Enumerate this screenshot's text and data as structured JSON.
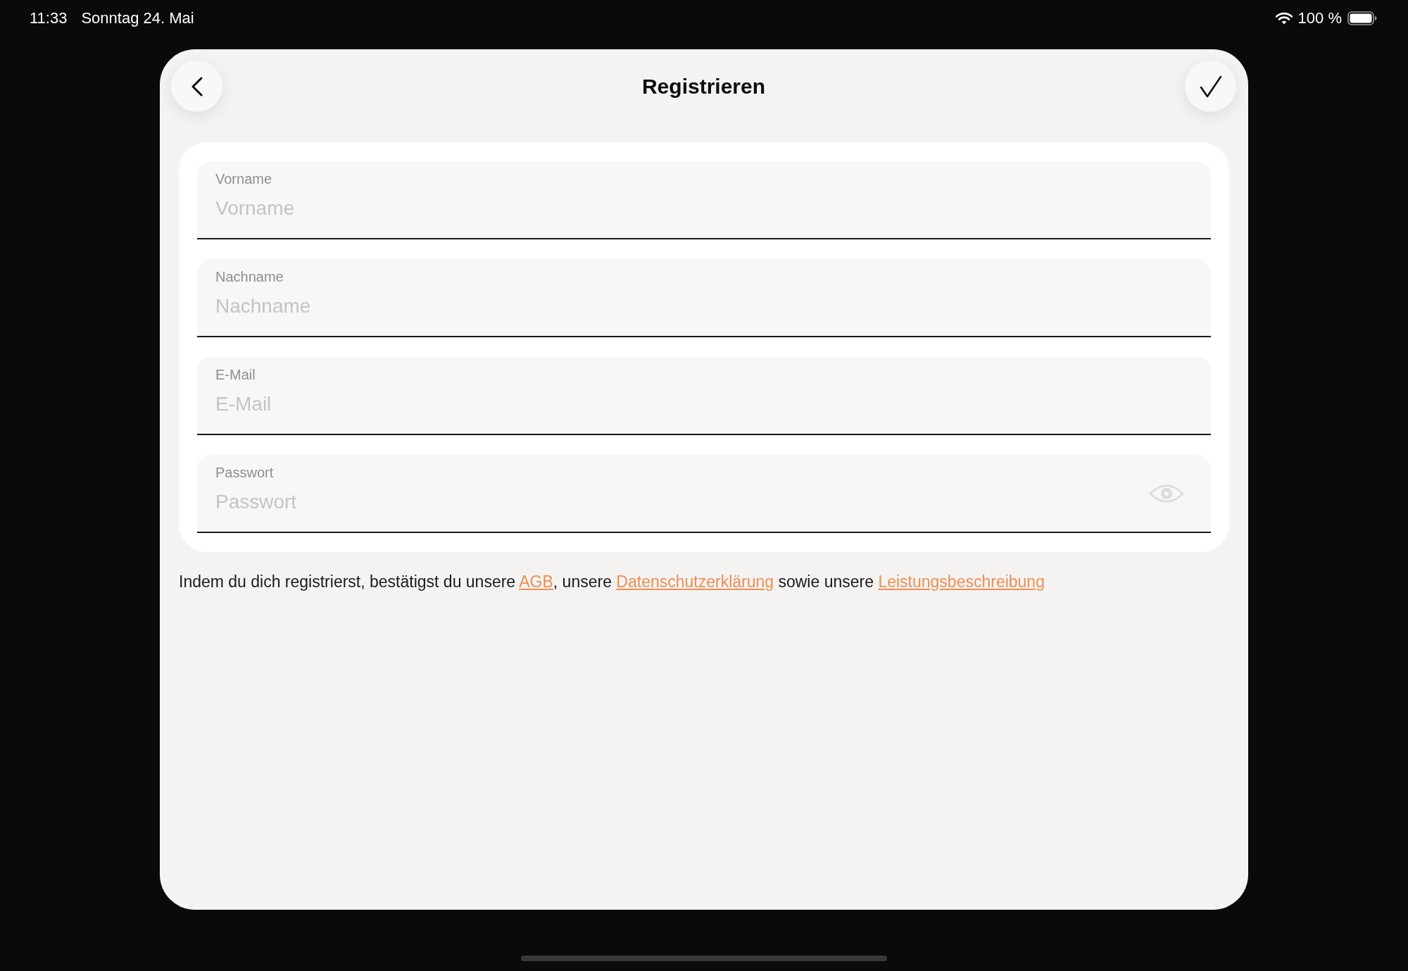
{
  "status_bar": {
    "time": "11:33",
    "date": "Sonntag 24. Mai",
    "battery": "100 %"
  },
  "header": {
    "title": "Registrieren"
  },
  "form": {
    "fields": [
      {
        "kind": "text",
        "label": "Vorname",
        "placeholder": "Vorname"
      },
      {
        "kind": "text",
        "label": "Nachname",
        "placeholder": "Nachname"
      },
      {
        "kind": "email",
        "label": "E-Mail",
        "placeholder": "E-Mail"
      },
      {
        "kind": "password",
        "label": "Passwort",
        "placeholder": "Passwort"
      }
    ]
  },
  "consent": {
    "segments": [
      {
        "kind": "text",
        "text": "Indem du dich registrierst, bestätigst du unsere "
      },
      {
        "kind": "link",
        "text": "AGB"
      },
      {
        "kind": "text",
        "text": ", unsere "
      },
      {
        "kind": "link",
        "text": "Datenschutzerklärung"
      },
      {
        "kind": "text",
        "text": " sowie unsere "
      },
      {
        "kind": "link",
        "text": "Leistungsbeschreibung"
      }
    ]
  }
}
